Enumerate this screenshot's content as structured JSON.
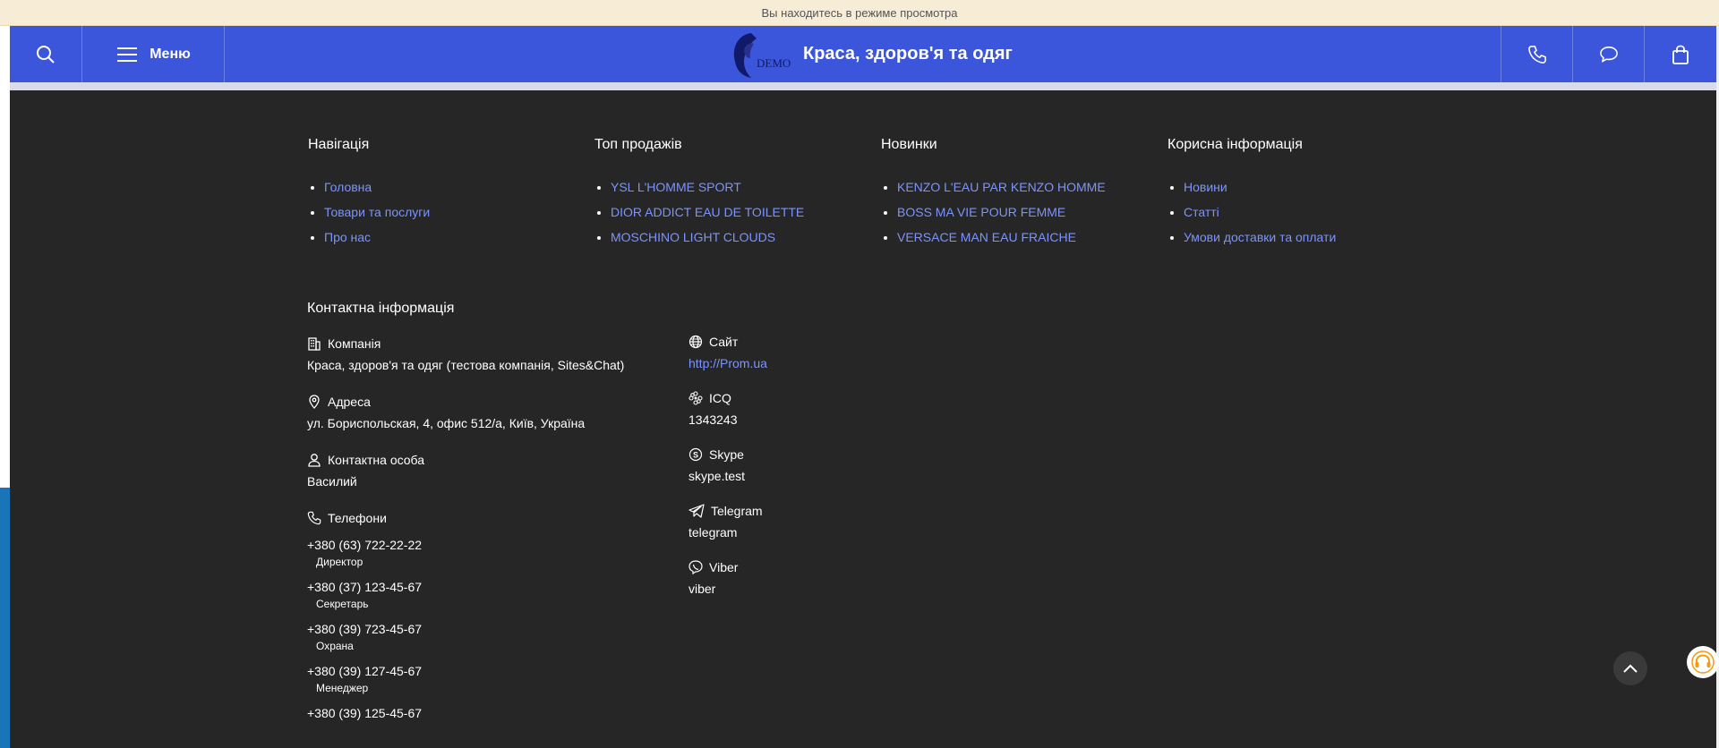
{
  "banner": {
    "text": "Вы находитесь в режиме просмотра"
  },
  "header": {
    "menu_label": "Меню",
    "title": "Краса, здоров'я та одяг",
    "logo_text": "DEMO",
    "icons": [
      "search-icon",
      "hamburger-icon",
      "phone-icon",
      "chat-icon",
      "bag-icon"
    ],
    "accent_color": "#3b55db"
  },
  "footer": {
    "columns": [
      {
        "title": "Навігація",
        "items": [
          "Головна",
          "Товари та послуги",
          "Про нас"
        ]
      },
      {
        "title": "Топ продажів",
        "items": [
          "YSL L'HOMME SPORT",
          "DIOR ADDICT EAU DE TOILETTE",
          "MOSCHINO LIGHT CLOUDS"
        ]
      },
      {
        "title": "Новинки",
        "items": [
          "KENZO L'EAU PAR KENZO HOMME",
          "BOSS MA VIE POUR FEMME",
          "VERSACE MAN EAU FRAICHE"
        ]
      },
      {
        "title": "Корисна інформація",
        "items": [
          "Новини",
          "Статті",
          "Умови доставки та оплати"
        ]
      }
    ],
    "contacts": {
      "title": "Контактна інформація",
      "company_label": "Компанія",
      "company_value": "Краса, здоров'я та одяг (тестова компанія, Sites&Chat)",
      "address_label": "Адреса",
      "address_value": "ул. Бориспольская, 4, офис 512/а, Київ, Україна",
      "person_label": "Контактна особа",
      "person_value": "Василий",
      "phones_label": "Телефони",
      "phones": [
        {
          "number": "+380 (63) 722-22-22",
          "note": "Директор"
        },
        {
          "number": "+380 (37) 123-45-67",
          "note": "Секретарь"
        },
        {
          "number": "+380 (39) 723-45-67",
          "note": "Охрана"
        },
        {
          "number": "+380 (39) 127-45-67",
          "note": "Менеджер"
        },
        {
          "number": "+380 (39) 125-45-67",
          "note": ""
        }
      ],
      "site_label": "Сайт",
      "site_value": "http://Prom.ua",
      "icq_label": "ICQ",
      "icq_value": "1343243",
      "skype_label": "Skype",
      "skype_value": "skype.test",
      "telegram_label": "Telegram",
      "telegram_value": "telegram",
      "viber_label": "Viber",
      "viber_value": "viber"
    },
    "link_color": "#7b93ff",
    "background": "#262626"
  }
}
